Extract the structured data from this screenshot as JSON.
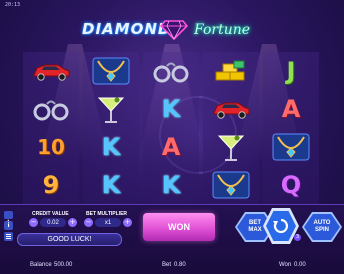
{
  "status_bar": {
    "clock": "20:13"
  },
  "logo": {
    "left_word": "DIAMOND",
    "right_word": "Fortune"
  },
  "colors": {
    "accent_pink": "#e152d6",
    "accent_blue": "#2b59d9",
    "background": "#2a1660"
  },
  "reels": [
    [
      "car",
      "handcuffs",
      "10",
      "9"
    ],
    [
      "necklace",
      "martini",
      "K",
      "K"
    ],
    [
      "handcuffs",
      "K",
      "A",
      "K"
    ],
    [
      "gold-bars",
      "car",
      "martini",
      "necklace"
    ],
    [
      "J",
      "A",
      "necklace",
      "Q"
    ]
  ],
  "controls": {
    "credit_value_label": "CREDIT VALUE",
    "credit_value": "0.02",
    "bet_multiplier_label": "BET MULTIPLIER",
    "bet_multiplier": "x1",
    "minus": "−",
    "plus": "+",
    "message": "GOOD LUCK!",
    "win_button": "WON",
    "bet_max_button": "BET\nMAX",
    "auto_spin_button": "AUTO\nSPIN",
    "spin_badge": "3",
    "info_button": "i"
  },
  "footer": {
    "balance_label": "Balance",
    "balance": "500.00",
    "bet_label": "Bet",
    "bet": "0.80",
    "won_label": "Won",
    "won": "0.00"
  }
}
